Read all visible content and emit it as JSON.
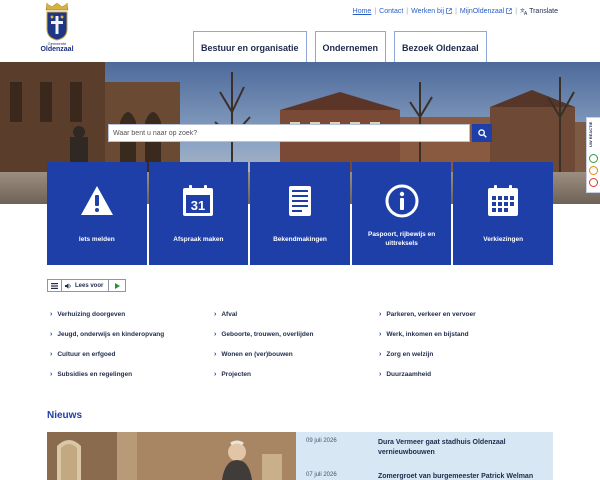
{
  "logo": {
    "gemeente": "Gemeente",
    "name": "Oldenzaal"
  },
  "toplinks": {
    "home": "Home",
    "contact": "Contact",
    "werken_bij": "Werken bij",
    "mijn": "MijnOldenzaal",
    "translate": "Translate"
  },
  "nav": {
    "tabs": [
      {
        "label": "Bestuur en organisatie"
      },
      {
        "label": "Ondernemen"
      },
      {
        "label": "Bezoek Oldenzaal"
      }
    ]
  },
  "search": {
    "placeholder": "Waar bent u naar op zoek?"
  },
  "feedback": {
    "label": "UW REACTIE"
  },
  "tiles": [
    {
      "label": "Iets melden",
      "icon": "warning-icon"
    },
    {
      "label": "Afspraak maken",
      "icon": "calendar-31-icon",
      "number": "31"
    },
    {
      "label": "Bekendmakingen",
      "icon": "document-icon"
    },
    {
      "label": "Paspoort, rijbewijs en uittreksels",
      "icon": "info-icon"
    },
    {
      "label": "Verkiezingen",
      "icon": "calendar-grid-icon"
    }
  ],
  "readaloud": {
    "label": "Lees voor"
  },
  "links": {
    "col1": [
      "Verhuizing doorgeven",
      "Jeugd, onderwijs en kinderopvang",
      "Cultuur en erfgoed",
      "Subsidies en regelingen"
    ],
    "col2": [
      "Afval",
      "Geboorte, trouwen, overlijden",
      "Wonen en (ver)bouwen",
      "Projecten"
    ],
    "col3": [
      "Parkeren, verkeer en vervoer",
      "Werk, inkomen en bijstand",
      "Zorg en welzijn",
      "Duurzaamheid"
    ]
  },
  "news": {
    "title": "Nieuws",
    "items": [
      {
        "date": "09 juli 2026",
        "headline": "Dura Vermeer gaat stadhuis Oldenzaal vernieuwbouwen"
      },
      {
        "date": "07 juli 2026",
        "headline": "Zomergroet van burgemeester Patrick Welman"
      }
    ]
  },
  "colors": {
    "primary": "#1e3fa8",
    "link": "#2a5ec4",
    "text": "#1f2b4d",
    "news_bg": "#d7e7f3"
  }
}
